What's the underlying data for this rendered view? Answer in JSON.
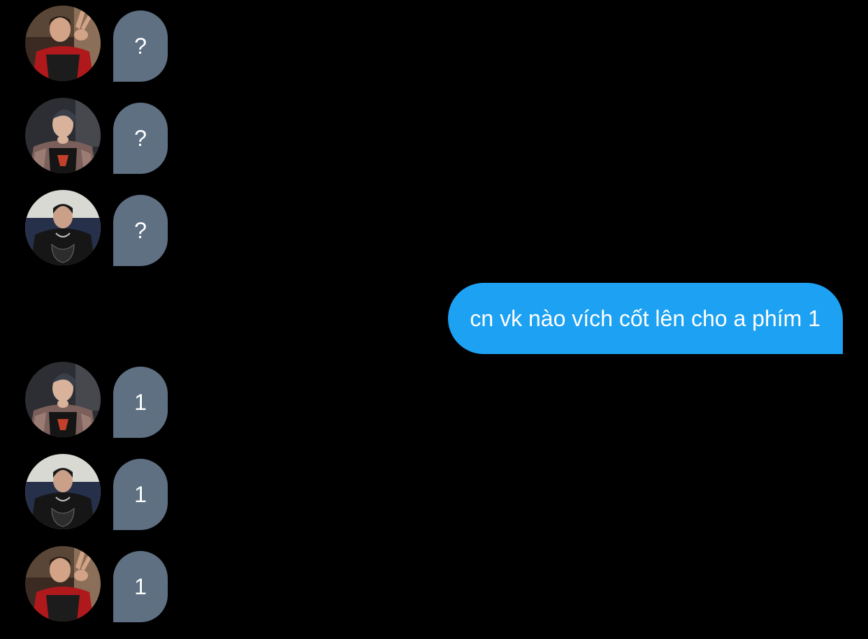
{
  "messages": [
    {
      "direction": "incoming",
      "sender_avatar": "avatar-red-jacket-peace-sign",
      "text": "?"
    },
    {
      "direction": "incoming",
      "sender_avatar": "avatar-patterned-jacket",
      "text": "?"
    },
    {
      "direction": "incoming",
      "sender_avatar": "avatar-black-hoodie",
      "text": "?"
    },
    {
      "direction": "outgoing",
      "text": "cn vk nào vích cốt lên cho a phím 1"
    },
    {
      "direction": "incoming",
      "sender_avatar": "avatar-patterned-jacket",
      "text": "1"
    },
    {
      "direction": "incoming",
      "sender_avatar": "avatar-black-hoodie",
      "text": "1"
    },
    {
      "direction": "incoming",
      "sender_avatar": "avatar-red-jacket-peace-sign",
      "text": "1"
    }
  ],
  "colors": {
    "background": "#000000",
    "incoming_bubble": "#5e7082",
    "outgoing_bubble": "#1da1f2",
    "text": "#ffffff"
  }
}
